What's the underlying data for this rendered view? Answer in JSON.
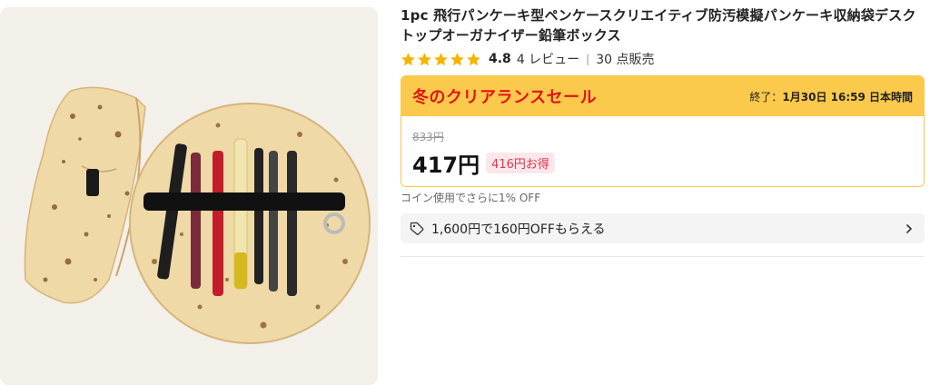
{
  "product": {
    "title": "1pc 飛行パンケーキ型ペンケースクリエイティブ防汚模擬パンケーキ収納袋デスクトップオーガナイザー鉛筆ボックス",
    "rating": "4.8",
    "rating_value": 4.8,
    "reviews": "4 レビュー",
    "separator": "|",
    "sold": "30 点販売",
    "image_alt_colors": {
      "tortilla": "#efd9a6",
      "spots": "#8a5a2b",
      "band": "#1a1a1a"
    }
  },
  "sale": {
    "title": "冬のクリアランスセール",
    "end_label": "終了：",
    "end_time": "1月30日 16:59 日本時間",
    "old_price": "833円",
    "price": "417円",
    "savings": "416円お得"
  },
  "coin_note": "コイン使用でさらに1% OFF",
  "coupon": {
    "icon": "tag-icon",
    "text": "1,600円で160円OFFもらえる",
    "chevron": "chevron-right-icon"
  },
  "colors": {
    "star": "#f7b500",
    "sale_banner": "#fbc94b",
    "sale_title": "#e01515",
    "savings_bg": "#fde7ea",
    "savings_text": "#e0364d"
  }
}
